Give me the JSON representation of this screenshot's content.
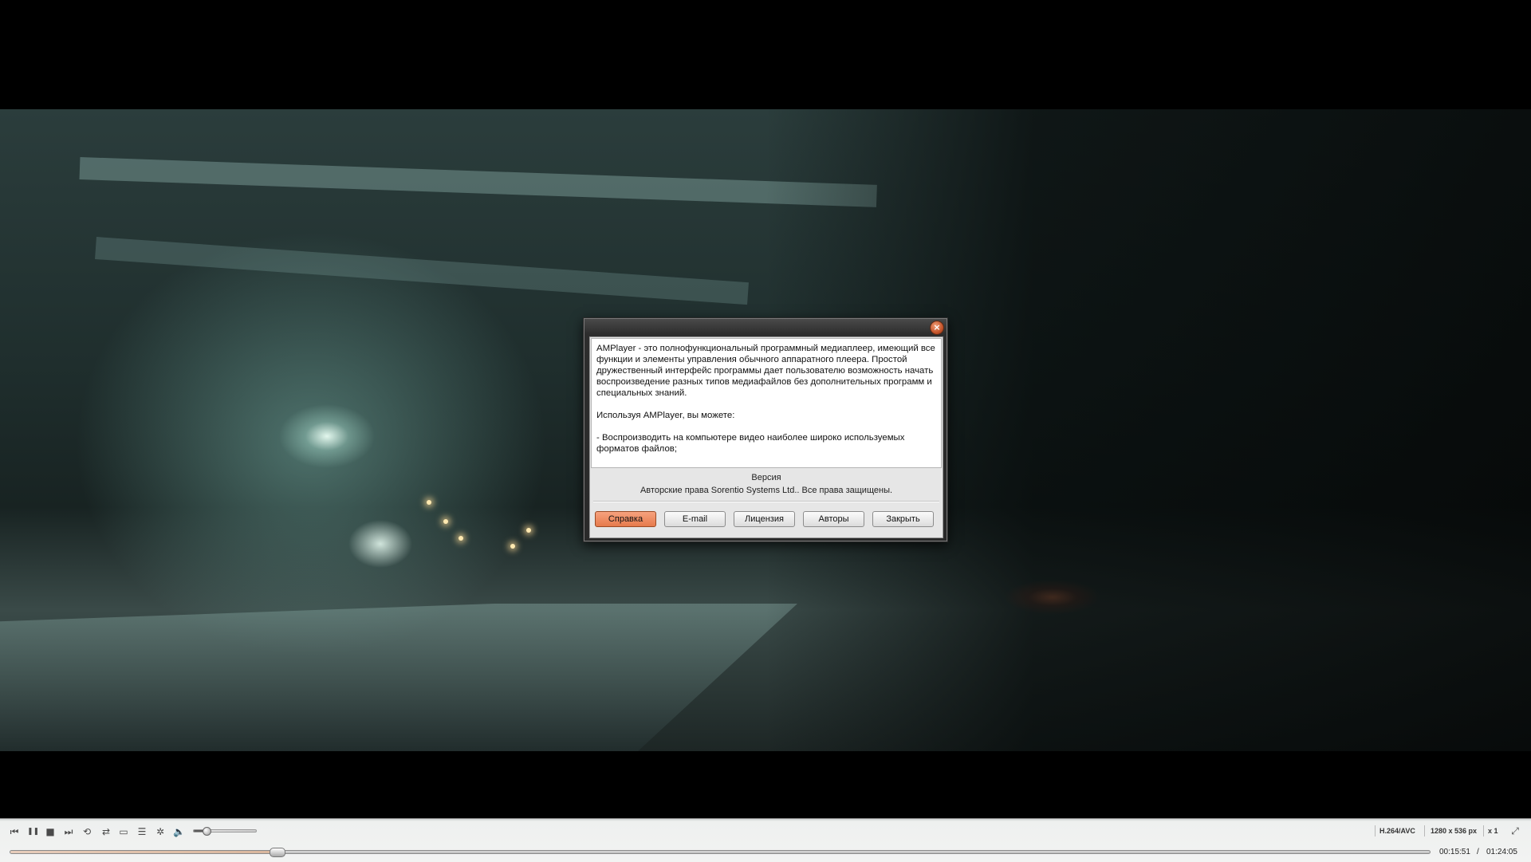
{
  "dialog": {
    "close_glyph": "×",
    "description_paragraphs": [
      "AMPlayer - это полнофункциональный программный медиаплеер, имеющий все функции и элементы управления обычного аппаратного плеера. Простой дружественный интерфейс программы дает пользователю возможность начать воспроизведение разных типов медиафайлов без дополнительных программ и специальных знаний.",
      "Используя AMPlayer, вы можете:",
      "- Воспроизводить на компьютере видео наиболее широко используемых форматов файлов;"
    ],
    "version_label": "Версия",
    "copyright": "Авторские права Sorentio Systems Ltd.. Все права защищены.",
    "buttons": {
      "help": "Справка",
      "email": "E-mail",
      "license": "Лицензия",
      "authors": "Авторы",
      "close": "Закрыть"
    },
    "accent_color": "#e67a4c"
  },
  "controls": {
    "icons": {
      "prev": "⏮",
      "pause": "❚❚",
      "stop": "■",
      "next": "⏭",
      "repeat": "⟲",
      "shuffle": "⇄",
      "screenshot": "▭",
      "playlist": "☰",
      "settings": "✲",
      "volume": "🔈",
      "fullscreen": "⤢"
    },
    "volume_level": 0.2,
    "codec": "H.264/AVC",
    "resolution": "1280 x 536 px",
    "speed": "x 1",
    "seek_progress": 0.1875,
    "time_current": "00:15:51",
    "time_separator": "/",
    "time_total": "01:24:05"
  }
}
